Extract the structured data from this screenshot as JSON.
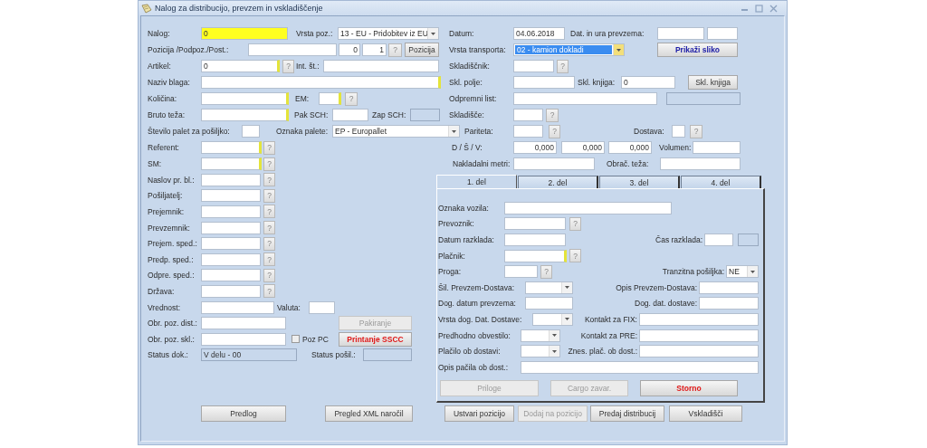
{
  "window": {
    "title": "Nalog za distribucijo, prevzem in vskladiščenje"
  },
  "rows": [
    {
      "items": [
        {
          "kind": "label",
          "text": "Nalog:"
        },
        {
          "kind": "field",
          "value": "0",
          "required": false,
          "highlighted": true
        },
        {
          "kind": "label",
          "text": "Vrsta poz.:"
        },
        {
          "kind": "combo",
          "value": "13 - EU - Pridobitev iz EU",
          "focused": false
        },
        {
          "kind": "label",
          "text": "Datum:"
        },
        {
          "kind": "field",
          "value": "04.06.2018",
          "required": false
        },
        {
          "kind": "label",
          "text": "Dat. in ura prevzema:"
        },
        {
          "kind": "field",
          "required": false
        },
        {
          "kind": "field",
          "required": false
        }
      ]
    },
    {
      "items": [
        {
          "kind": "label",
          "text": "Pozicija /Podpoz./Post.:"
        },
        {
          "kind": "field",
          "required": false
        },
        {
          "kind": "field",
          "value": "0",
          "required": false
        },
        {
          "kind": "field",
          "value": "1",
          "required": false
        },
        {
          "kind": "help",
          "text": "?"
        },
        {
          "kind": "button",
          "text": "Pozicija",
          "disabled": false
        },
        {
          "kind": "label",
          "text": "Vrsta transporta:"
        },
        {
          "kind": "combo",
          "value": "02 - kamion dokladi",
          "focused": true
        },
        {
          "kind": "primary",
          "text": "Prikaži sliko",
          "disabled": false
        }
      ]
    },
    {
      "items": [
        {
          "kind": "label",
          "text": "Artikel:"
        },
        {
          "kind": "field",
          "value": "0",
          "required": true
        },
        {
          "kind": "help",
          "text": "?"
        },
        {
          "kind": "label",
          "text": "Int. št.:"
        },
        {
          "kind": "field",
          "required": false
        },
        {
          "kind": "label",
          "text": "Skladiščnik:"
        },
        {
          "kind": "field",
          "required": false
        },
        {
          "kind": "help",
          "text": "?"
        }
      ]
    },
    {
      "items": [
        {
          "kind": "label",
          "text": "Naziv blaga:"
        },
        {
          "kind": "field",
          "required": true
        },
        {
          "kind": "label",
          "text": "Skl. polje:"
        },
        {
          "kind": "field",
          "required": false
        },
        {
          "kind": "label",
          "text": "Skl. knjiga:"
        },
        {
          "kind": "field",
          "value": "0",
          "required": false
        },
        {
          "kind": "button",
          "text": "Skl. knjiga",
          "disabled": false
        }
      ]
    },
    {
      "items": [
        {
          "kind": "label",
          "text": "Količina:"
        },
        {
          "kind": "field",
          "required": true
        },
        {
          "kind": "label",
          "text": "EM:"
        },
        {
          "kind": "field",
          "required": true
        },
        {
          "kind": "help",
          "text": "?"
        },
        {
          "kind": "label",
          "text": "Odpremni list:"
        },
        {
          "kind": "field",
          "required": false
        },
        {
          "kind": "display"
        }
      ]
    },
    {
      "items": [
        {
          "kind": "label",
          "text": "Bruto teža:"
        },
        {
          "kind": "field",
          "required": true
        },
        {
          "kind": "label",
          "text": "Pak SCH:"
        },
        {
          "kind": "field",
          "required": false
        },
        {
          "kind": "label",
          "text": "Zap SCH:"
        },
        {
          "kind": "display"
        },
        {
          "kind": "label",
          "text": "Skladišče:"
        },
        {
          "kind": "field",
          "required": false
        },
        {
          "kind": "help",
          "text": "?"
        }
      ]
    },
    {
      "items": [
        {
          "kind": "label",
          "text": "Število palet za pošiljko:"
        },
        {
          "kind": "field",
          "required": false
        },
        {
          "kind": "label",
          "text": "Oznaka palete:"
        },
        {
          "kind": "combo",
          "value": "EP - Europallet",
          "focused": false
        },
        {
          "kind": "label",
          "text": "Pariteta:"
        },
        {
          "kind": "field",
          "required": false
        },
        {
          "kind": "help",
          "text": "?"
        },
        {
          "kind": "label",
          "text": "Dostava:"
        },
        {
          "kind": "field",
          "required": false
        },
        {
          "kind": "help",
          "text": "?"
        }
      ]
    },
    {
      "items": [
        {
          "kind": "label",
          "text": "Referent:"
        },
        {
          "kind": "field",
          "required": true
        },
        {
          "kind": "help",
          "text": "?"
        },
        {
          "kind": "label",
          "text": "D / Š / V:"
        },
        {
          "kind": "field",
          "value": "0,000",
          "required": false
        },
        {
          "kind": "field",
          "value": "0,000",
          "required": false
        },
        {
          "kind": "field",
          "value": "0,000",
          "required": false
        },
        {
          "kind": "label",
          "text": "Volumen:"
        },
        {
          "kind": "field",
          "required": false
        }
      ]
    },
    {
      "items": [
        {
          "kind": "label",
          "text": "SM:"
        },
        {
          "kind": "field",
          "required": true
        },
        {
          "kind": "help",
          "text": "?"
        },
        {
          "kind": "label",
          "text": "Nakladalni metri:"
        },
        {
          "kind": "field",
          "required": false
        },
        {
          "kind": "label",
          "text": "Obrač. teža:"
        },
        {
          "kind": "field",
          "required": false
        }
      ]
    }
  ],
  "left_rows": [
    {
      "items": [
        {
          "kind": "label",
          "text": "Naslov pr. bl.:"
        },
        {
          "kind": "field",
          "required": false
        },
        {
          "kind": "help",
          "text": "?"
        }
      ]
    },
    {
      "items": [
        {
          "kind": "label",
          "text": "Pošiljatelj:"
        },
        {
          "kind": "field",
          "required": false
        },
        {
          "kind": "help",
          "text": "?"
        }
      ]
    },
    {
      "items": [
        {
          "kind": "label",
          "text": "Prejemnik:"
        },
        {
          "kind": "field",
          "required": false
        },
        {
          "kind": "help",
          "text": "?"
        }
      ]
    },
    {
      "items": [
        {
          "kind": "label",
          "text": "Prevzemnik:"
        },
        {
          "kind": "field",
          "required": false
        },
        {
          "kind": "help",
          "text": "?"
        }
      ]
    },
    {
      "items": [
        {
          "kind": "label",
          "text": "Prejem. sped.:"
        },
        {
          "kind": "field",
          "required": false
        },
        {
          "kind": "help",
          "text": "?"
        }
      ]
    },
    {
      "items": [
        {
          "kind": "label",
          "text": "Predp. sped.:"
        },
        {
          "kind": "field",
          "required": false
        },
        {
          "kind": "help",
          "text": "?"
        }
      ]
    },
    {
      "items": [
        {
          "kind": "label",
          "text": "Odpre. sped.:"
        },
        {
          "kind": "field",
          "required": false
        },
        {
          "kind": "help",
          "text": "?"
        }
      ]
    },
    {
      "items": [
        {
          "kind": "label",
          "text": "Država:"
        },
        {
          "kind": "field",
          "required": false
        },
        {
          "kind": "help",
          "text": "?"
        }
      ]
    },
    {
      "items": [
        {
          "kind": "label",
          "text": "Vrednost:"
        },
        {
          "kind": "field",
          "required": false
        },
        {
          "kind": "label",
          "text": "Valuta:"
        },
        {
          "kind": "field",
          "required": false
        }
      ]
    },
    {
      "items": [
        {
          "kind": "label",
          "text": "Obr. poz. dist.:"
        },
        {
          "kind": "field",
          "required": false
        },
        {
          "kind": "button",
          "text": "Pakiranje",
          "disabled": true
        }
      ]
    },
    {
      "items": [
        {
          "kind": "label",
          "text": "Obr. poz. skl.:"
        },
        {
          "kind": "field",
          "required": false
        },
        {
          "kind": "checkbox",
          "text": "Poz PC",
          "checked": false
        },
        {
          "kind": "danger",
          "text": "Printanje SSCC",
          "disabled": false
        }
      ]
    },
    {
      "items": [
        {
          "kind": "label",
          "text": "Status dok.:"
        },
        {
          "kind": "display",
          "value": "V delu - 00"
        },
        {
          "kind": "label",
          "text": "Status pošil.:"
        },
        {
          "kind": "display"
        }
      ]
    }
  ],
  "tabs": [
    {
      "label": "1. del",
      "selected": true
    },
    {
      "label": "2. del",
      "selected": false
    },
    {
      "label": "3. del",
      "selected": false
    },
    {
      "label": "4. del",
      "selected": false
    }
  ],
  "panel_rows": [
    {
      "items": [
        {
          "kind": "label",
          "text": "Oznaka vozila:"
        },
        {
          "kind": "field",
          "required": false
        }
      ]
    },
    {
      "items": [
        {
          "kind": "label",
          "text": "Prevoznik:"
        },
        {
          "kind": "field",
          "required": false
        },
        {
          "kind": "help",
          "text": "?"
        }
      ]
    },
    {
      "items": [
        {
          "kind": "label",
          "text": "Datum razklada:"
        },
        {
          "kind": "field",
          "required": false
        },
        {
          "kind": "label",
          "text": "Čas razklada:"
        },
        {
          "kind": "field",
          "required": false
        },
        {
          "kind": "display"
        }
      ]
    },
    {
      "items": [
        {
          "kind": "label",
          "text": "Plačnik:"
        },
        {
          "kind": "field",
          "required": true
        },
        {
          "kind": "help",
          "text": "?"
        }
      ]
    },
    {
      "items": [
        {
          "kind": "label",
          "text": "Proga:"
        },
        {
          "kind": "field",
          "required": false
        },
        {
          "kind": "help",
          "text": "?"
        },
        {
          "kind": "label",
          "text": "Tranzitna pošiljka:"
        },
        {
          "kind": "combo",
          "value": "NE",
          "focused": false
        }
      ]
    },
    {
      "items": [
        {
          "kind": "label",
          "text": "Šil. Prevzem-Dostava:"
        },
        {
          "kind": "combo",
          "focused": false
        },
        {
          "kind": "label",
          "text": "Opis Prevzem-Dostava:"
        },
        {
          "kind": "field",
          "required": false
        }
      ]
    },
    {
      "items": [
        {
          "kind": "label",
          "text": "Dog. datum prevzema:"
        },
        {
          "kind": "field",
          "required": false
        },
        {
          "kind": "label",
          "text": "Dog. dat. dostave:"
        },
        {
          "kind": "field",
          "required": false
        }
      ]
    },
    {
      "items": [
        {
          "kind": "label",
          "text": "Vrsta dog. Dat. Dostave:"
        },
        {
          "kind": "combo",
          "focused": false
        },
        {
          "kind": "label",
          "text": "Kontakt za FIX:"
        },
        {
          "kind": "field",
          "required": false
        }
      ]
    },
    {
      "items": [
        {
          "kind": "label",
          "text": "Predhodno obvestilo:"
        },
        {
          "kind": "combo",
          "focused": false
        },
        {
          "kind": "label",
          "text": "Kontakt za PRE:"
        },
        {
          "kind": "field",
          "required": false
        }
      ]
    },
    {
      "items": [
        {
          "kind": "label",
          "text": "Plačilo ob dostavi:"
        },
        {
          "kind": "combo",
          "focused": false
        },
        {
          "kind": "label",
          "text": "Znes. plač. ob dost.:"
        },
        {
          "kind": "field",
          "required": false
        }
      ]
    },
    {
      "items": [
        {
          "kind": "label",
          "text": "Opis pačila ob dost.:"
        },
        {
          "kind": "field",
          "required": false
        }
      ]
    }
  ],
  "panel_buttons": [
    {
      "kind": "button",
      "text": "Priloge",
      "disabled": true
    },
    {
      "kind": "button",
      "text": "Cargo zavar.",
      "disabled": true
    },
    {
      "kind": "danger",
      "text": "Storno",
      "disabled": false
    }
  ],
  "footer_buttons": [
    {
      "kind": "button",
      "text": "Predlog",
      "disabled": false
    },
    {
      "kind": "button",
      "text": "Pregled XML naročil",
      "disabled": false
    },
    {
      "kind": "button",
      "text": "Ustvari pozicijo",
      "disabled": false
    },
    {
      "kind": "button",
      "text": "Dodaj na pozicijo",
      "disabled": true
    },
    {
      "kind": "button",
      "text": "Predaj distribucij",
      "disabled": false
    },
    {
      "kind": "button",
      "text": "Vskladišči",
      "disabled": false
    }
  ]
}
